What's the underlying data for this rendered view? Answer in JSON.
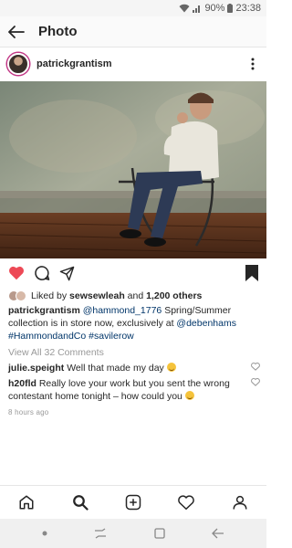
{
  "status_bar": {
    "battery": "90%",
    "time": "23:38"
  },
  "header": {
    "title": "Photo"
  },
  "post": {
    "username": "patrickgrantism",
    "likes": {
      "prefix": "Liked by",
      "user": "sewsewleah",
      "joiner": "and",
      "others": "1,200 others"
    },
    "caption": {
      "username": "patrickgrantism",
      "mention1": "@hammond_1776",
      "text1": "Spring/Summer collection is in store now, exclusively at",
      "mention2": "@debenhams",
      "hashtag1": "#HammondandCo",
      "hashtag2": "#savilerow"
    },
    "view_all": "View All 32 Comments",
    "comments": [
      {
        "user": "julie.speight",
        "text": "Well that made my day"
      },
      {
        "user": "h20fld",
        "text": "Really love your work but you sent the wrong contestant home tonight – how could you"
      }
    ],
    "time_ago": "8 hours ago"
  },
  "colors": {
    "like": "#ed4956",
    "link": "#003569",
    "muted": "#999999"
  },
  "icons": {
    "header": "back-arrow-icon",
    "actions": [
      "heart-filled-icon",
      "comment-icon",
      "share-icon",
      "bookmark-filled-icon"
    ],
    "bottom_nav": [
      "home-icon",
      "search-icon",
      "new-post-icon",
      "activity-icon",
      "profile-icon"
    ]
  }
}
